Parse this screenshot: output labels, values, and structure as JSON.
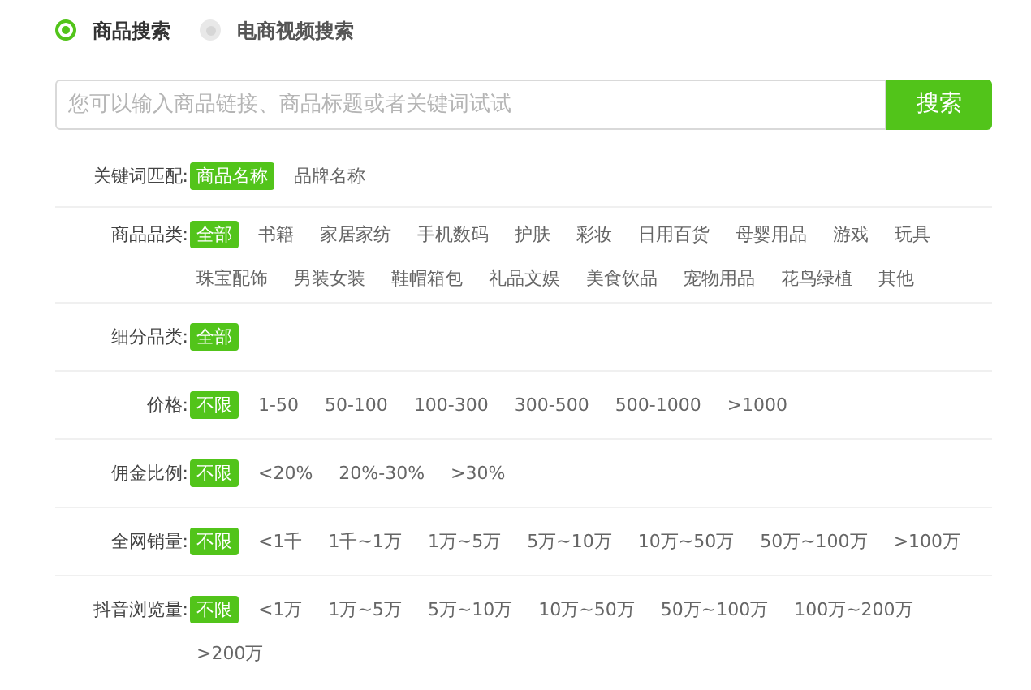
{
  "search_modes": [
    {
      "label": "商品搜索",
      "selected": true
    },
    {
      "label": "电商视频搜索",
      "selected": false
    }
  ],
  "search": {
    "placeholder": "您可以输入商品链接、商品标题或者关键词试试",
    "button": "搜索"
  },
  "filters": [
    {
      "label": "关键词匹配:",
      "options": [
        {
          "label": "商品名称",
          "selected": true
        },
        {
          "label": "品牌名称",
          "selected": false
        }
      ]
    },
    {
      "label": "商品品类:",
      "options": [
        {
          "label": "全部",
          "selected": true
        },
        {
          "label": "书籍",
          "selected": false
        },
        {
          "label": "家居家纺",
          "selected": false
        },
        {
          "label": "手机数码",
          "selected": false
        },
        {
          "label": "护肤",
          "selected": false
        },
        {
          "label": "彩妆",
          "selected": false
        },
        {
          "label": "日用百货",
          "selected": false
        },
        {
          "label": "母婴用品",
          "selected": false
        },
        {
          "label": "游戏",
          "selected": false
        },
        {
          "label": "玩具",
          "selected": false
        },
        {
          "label": "珠宝配饰",
          "selected": false
        },
        {
          "label": "男装女装",
          "selected": false
        },
        {
          "label": "鞋帽箱包",
          "selected": false
        },
        {
          "label": "礼品文娱",
          "selected": false
        },
        {
          "label": "美食饮品",
          "selected": false
        },
        {
          "label": "宠物用品",
          "selected": false
        },
        {
          "label": "花鸟绿植",
          "selected": false
        },
        {
          "label": "其他",
          "selected": false
        }
      ]
    },
    {
      "label": "细分品类:",
      "options": [
        {
          "label": "全部",
          "selected": true
        }
      ]
    },
    {
      "label": "价格:",
      "options": [
        {
          "label": "不限",
          "selected": true
        },
        {
          "label": "1-50",
          "selected": false
        },
        {
          "label": "50-100",
          "selected": false
        },
        {
          "label": "100-300",
          "selected": false
        },
        {
          "label": "300-500",
          "selected": false
        },
        {
          "label": "500-1000",
          "selected": false
        },
        {
          "label": ">1000",
          "selected": false
        }
      ]
    },
    {
      "label": "佣金比例:",
      "options": [
        {
          "label": "不限",
          "selected": true
        },
        {
          "label": "<20%",
          "selected": false
        },
        {
          "label": "20%-30%",
          "selected": false
        },
        {
          "label": ">30%",
          "selected": false
        }
      ]
    },
    {
      "label": "全网销量:",
      "options": [
        {
          "label": "不限",
          "selected": true
        },
        {
          "label": "<1千",
          "selected": false
        },
        {
          "label": "1千~1万",
          "selected": false
        },
        {
          "label": "1万~5万",
          "selected": false
        },
        {
          "label": "5万~10万",
          "selected": false
        },
        {
          "label": "10万~50万",
          "selected": false
        },
        {
          "label": "50万~100万",
          "selected": false
        },
        {
          "label": ">100万",
          "selected": false
        }
      ]
    },
    {
      "label": "抖音浏览量:",
      "options": [
        {
          "label": "不限",
          "selected": true
        },
        {
          "label": "<1万",
          "selected": false
        },
        {
          "label": "1万~5万",
          "selected": false
        },
        {
          "label": "5万~10万",
          "selected": false
        },
        {
          "label": "10万~50万",
          "selected": false
        },
        {
          "label": "50万~100万",
          "selected": false
        },
        {
          "label": "100万~200万",
          "selected": false
        },
        {
          "label": ">200万",
          "selected": false
        }
      ]
    }
  ]
}
